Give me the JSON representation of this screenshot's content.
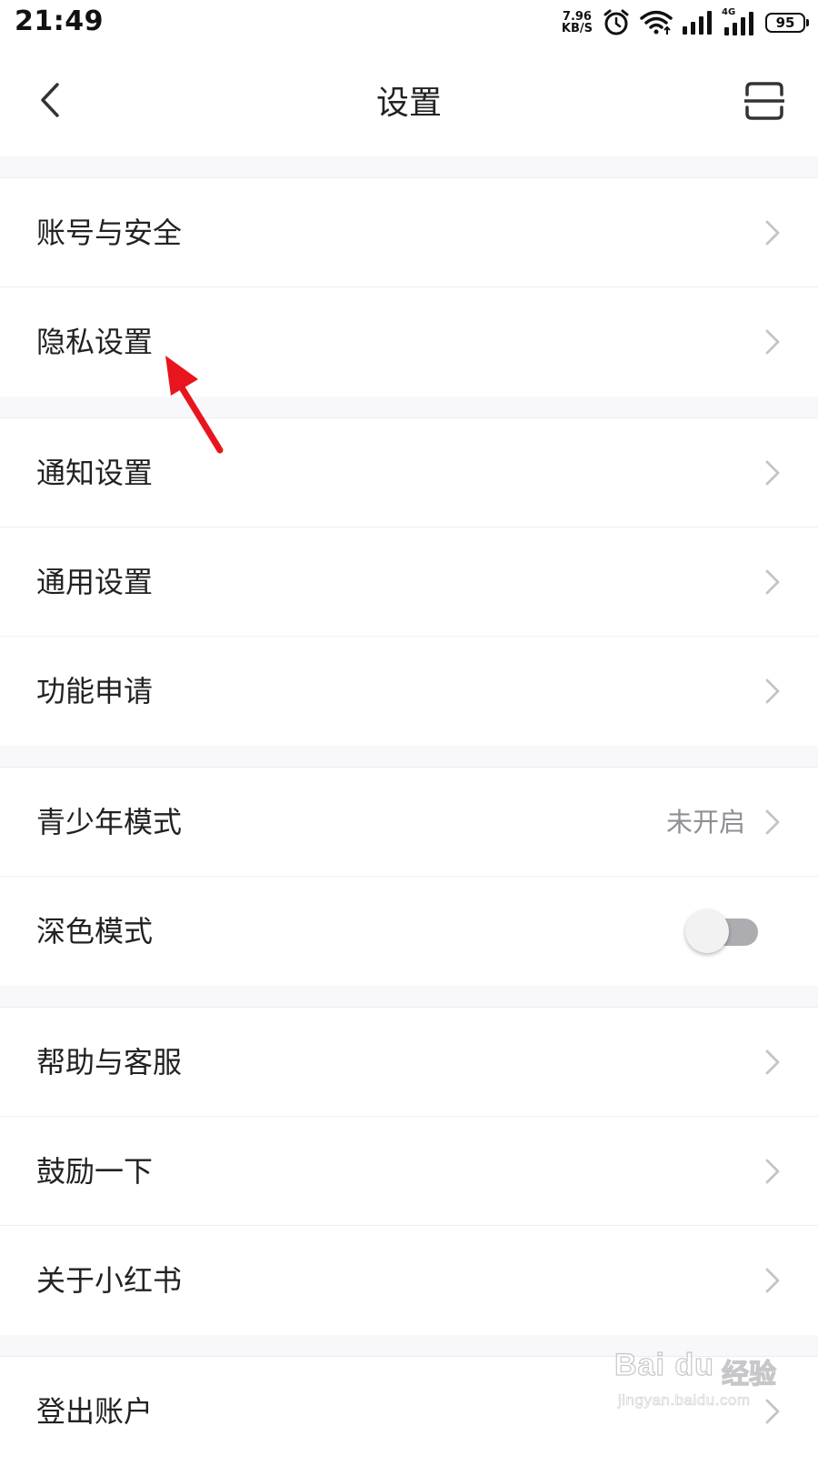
{
  "status_bar": {
    "time": "21:49",
    "net_speed_value": "7.96",
    "net_speed_unit": "KB/S",
    "network_type": "4G",
    "battery": "95"
  },
  "header": {
    "title": "设置"
  },
  "groups": [
    {
      "items": [
        {
          "label": "账号与安全"
        },
        {
          "label": "隐私设置"
        }
      ]
    },
    {
      "items": [
        {
          "label": "通知设置"
        },
        {
          "label": "通用设置"
        },
        {
          "label": "功能申请"
        }
      ]
    },
    {
      "items": [
        {
          "label": "青少年模式",
          "value": "未开启"
        },
        {
          "label": "深色模式",
          "toggle": false
        }
      ]
    },
    {
      "items": [
        {
          "label": "帮助与客服"
        },
        {
          "label": "鼓励一下"
        },
        {
          "label": "关于小红书"
        }
      ]
    },
    {
      "items": [
        {
          "label": "登出账户"
        }
      ]
    }
  ],
  "annotation": {
    "arrow_color": "#e8161c"
  },
  "watermark": {
    "brand": "Bai du",
    "brand_cn": "经验",
    "url": "jingyan.baidu.com"
  },
  "icons": {
    "back": "chevron-left-icon",
    "scan": "scan-icon",
    "row": "chevron-right-icon"
  }
}
